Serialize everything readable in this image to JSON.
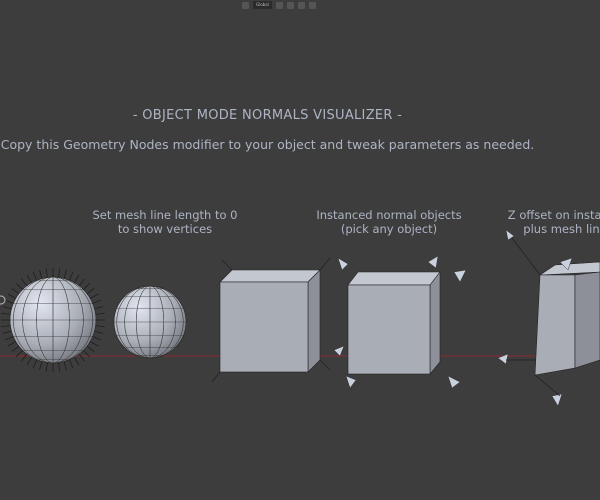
{
  "header": {
    "orientation_label": "Global"
  },
  "title": "- OBJECT MODE NORMALS VISUALIZER -",
  "subtitle": "Copy this Geometry Nodes modifier to your object and tweak parameters as needed.",
  "captions": [
    {
      "line1": "Set mesh line length to 0",
      "line2": "to show vertices"
    },
    {
      "line1": "Instanced normal objects",
      "line2": "(pick any object)"
    },
    {
      "line1": "Z offset on instances",
      "line2": "plus mesh lines"
    }
  ],
  "colors": {
    "background": "#3d3d3d",
    "text": "#aeb4c4",
    "x_axis": "#8a2b33",
    "mesh": "#a9adb6"
  }
}
